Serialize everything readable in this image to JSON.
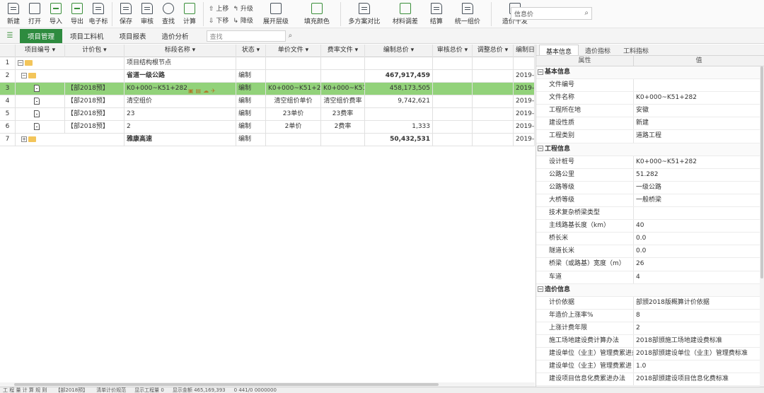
{
  "toolbar": {
    "buttons": [
      {
        "label": "新建",
        "icon": "new-file-icon"
      },
      {
        "label": "打开",
        "icon": "open-folder-icon"
      },
      {
        "label": "导入",
        "icon": "import-icon"
      },
      {
        "label": "导出",
        "icon": "export-icon"
      },
      {
        "label": "电子标",
        "icon": "e-bid-icon"
      },
      {
        "label": "保存",
        "icon": "save-icon"
      },
      {
        "label": "审核",
        "icon": "review-icon"
      },
      {
        "label": "查找",
        "icon": "find-icon"
      },
      {
        "label": "计算",
        "icon": "calculate-icon"
      }
    ],
    "move_up": "上移",
    "move_down": "下移",
    "upgrade": "升级",
    "downgrade": "降级",
    "buttons2": [
      {
        "label": "展开层级",
        "icon": "expand-levels-icon"
      },
      {
        "label": "填充颜色",
        "icon": "fill-color-icon"
      },
      {
        "label": "多方案对比",
        "icon": "compare-icon"
      },
      {
        "label": "材料调差",
        "icon": "material-diff-icon"
      },
      {
        "label": "结算",
        "icon": "settle-icon"
      },
      {
        "label": "统一组价",
        "icon": "unify-price-icon"
      },
      {
        "label": "造价十发",
        "icon": "cost-icon"
      }
    ],
    "search_label": "信息价"
  },
  "tabs": [
    "项目管理",
    "项目工料机",
    "项目报表",
    "造价分析"
  ],
  "tab_search_label": "查找",
  "columns": [
    "项目编号",
    "计价包",
    "标段名称",
    "状态",
    "单价文件",
    "费率文件",
    "编制总价",
    "审核总价",
    "调整总价",
    "编制日"
  ],
  "rows": [
    {
      "n": "1",
      "pkg": "",
      "name": "项目结构根节点",
      "status": "",
      "unit": "",
      "rate": "",
      "total": "",
      "date": ""
    },
    {
      "n": "2",
      "pkg": "",
      "name": "省道一级公路",
      "status": "编制",
      "unit": "",
      "rate": "",
      "total": "467,917,459",
      "date": "2019-"
    },
    {
      "n": "3",
      "pkg": "【部2018预】",
      "name": "K0+000~K51+282",
      "status": "编制",
      "unit": "K0+000~K51+282单",
      "rate": "K0+000~K51+282",
      "total": "458,173,505",
      "date": "2019-"
    },
    {
      "n": "4",
      "pkg": "【部2018预】",
      "name": "清空组价",
      "status": "编制",
      "unit": "清空组价单价",
      "rate": "清空组价费率",
      "total": "9,742,621",
      "date": "2019-"
    },
    {
      "n": "5",
      "pkg": "【部2018预】",
      "name": "23",
      "status": "编制",
      "unit": "23单价",
      "rate": "23费率",
      "total": "",
      "date": "2019-"
    },
    {
      "n": "6",
      "pkg": "【部2018预】",
      "name": "2",
      "status": "编制",
      "unit": "2单价",
      "rate": "2费率",
      "total": "1,333",
      "date": "2019-"
    },
    {
      "n": "7",
      "pkg": "",
      "name": "雅康高速",
      "status": "编制",
      "unit": "",
      "rate": "",
      "total": "50,432,531",
      "date": "2019-"
    }
  ],
  "right_panel": {
    "tabs": [
      "基本信息",
      "造价指标",
      "工料指标"
    ],
    "header_attr": "属性",
    "header_val": "值",
    "sections": [
      {
        "title": "基本信息",
        "items": [
          {
            "k": "文件编号",
            "v": ""
          },
          {
            "k": "文件名称",
            "v": "K0+000~K51+282"
          },
          {
            "k": "工程所在地",
            "v": "安徽"
          },
          {
            "k": "建设性质",
            "v": "新建"
          },
          {
            "k": "工程类别",
            "v": "道路工程"
          }
        ]
      },
      {
        "title": "工程信息",
        "items": [
          {
            "k": "设计桩号",
            "v": "K0+000~K51+282"
          },
          {
            "k": "公路公里",
            "v": "51.282"
          },
          {
            "k": "公路等级",
            "v": "一级公路"
          },
          {
            "k": "大桥等级",
            "v": "一般桥梁"
          },
          {
            "k": "技术复杂桥梁类型",
            "v": ""
          },
          {
            "k": "主线路基长度（km）",
            "v": "40"
          },
          {
            "k": "桥长米",
            "v": "0.0"
          },
          {
            "k": "隧道长米",
            "v": "0.0"
          },
          {
            "k": "桥梁（或路基）宽度（m）",
            "v": "26"
          },
          {
            "k": "车道",
            "v": "4"
          }
        ]
      },
      {
        "title": "造价信息",
        "items": [
          {
            "k": "计价依据",
            "v": "部颁2018版概算计价依据"
          },
          {
            "k": "年造价上涨率%",
            "v": "8"
          },
          {
            "k": "上涨计费年限",
            "v": "2"
          },
          {
            "k": "施工场地建设费计算办法",
            "v": "2018部颁施工场地建设费标准"
          },
          {
            "k": "建设单位（业主）管理费累进办法",
            "v": "2018部颁建设单位（业主）管理费标准"
          },
          {
            "k": "建设单位（业主）管理费累进",
            "v": "1.0"
          },
          {
            "k": "建设项目信息化费累进办法",
            "v": "2018部颁建设项目信息化费标准"
          }
        ]
      }
    ]
  },
  "status_bar": [
    "工 程 量 计 算 规 则",
    "【部2018预】",
    "清单计价规范",
    "显示工程量 0",
    "显示金额 465,169,393",
    "0  441/0  0000000"
  ]
}
